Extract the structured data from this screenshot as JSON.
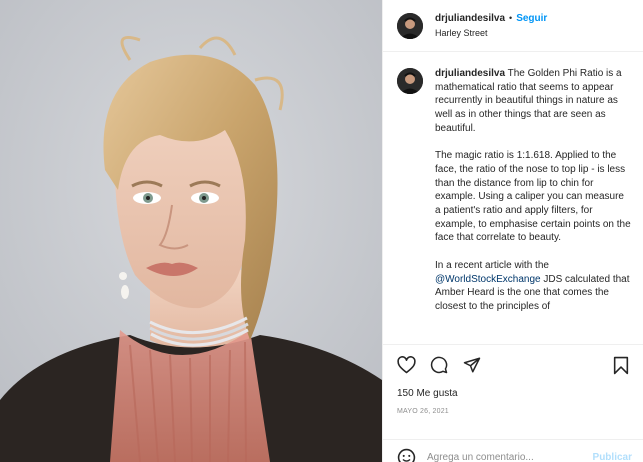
{
  "header": {
    "username": "drjuliandesilva",
    "separator": "•",
    "follow_label": "Seguir",
    "location": "Harley Street"
  },
  "caption": {
    "username": "drjuliandesilva",
    "paragraph1": "The Golden Phi Ratio is a mathematical ratio that seems to appear recurrently in beautiful things in nature as well as in other things that are seen as beautiful.",
    "paragraph2": "The magic ratio is 1:1.618. Applied to the face, the ratio of the nose to top lip - is less than the distance from lip to chin for example. Using a caliper you can measure a patient's ratio and apply filters, for example, to emphasise certain points on the face that correlate to beauty.",
    "paragraph3_prefix": "In a recent article with the ",
    "paragraph3_mention": "@WorldStockExchange",
    "paragraph3_suffix": " JDS calculated that Amber Heard is the one that comes the closest to the principles of"
  },
  "stats": {
    "likes": "150 Me gusta",
    "date": "MAYO 26, 2021"
  },
  "comment": {
    "placeholder": "Agrega un comentario...",
    "publish_label": "Publicar"
  },
  "icons": {
    "like": "heart-icon",
    "comment": "comment-icon",
    "share": "share-icon",
    "save": "bookmark-icon",
    "emoji": "emoji-icon"
  },
  "colors": {
    "link": "#0095f6",
    "publish_disabled": "#b2dffc",
    "secondary_text": "#8e8e8e",
    "mention": "#00376b"
  }
}
